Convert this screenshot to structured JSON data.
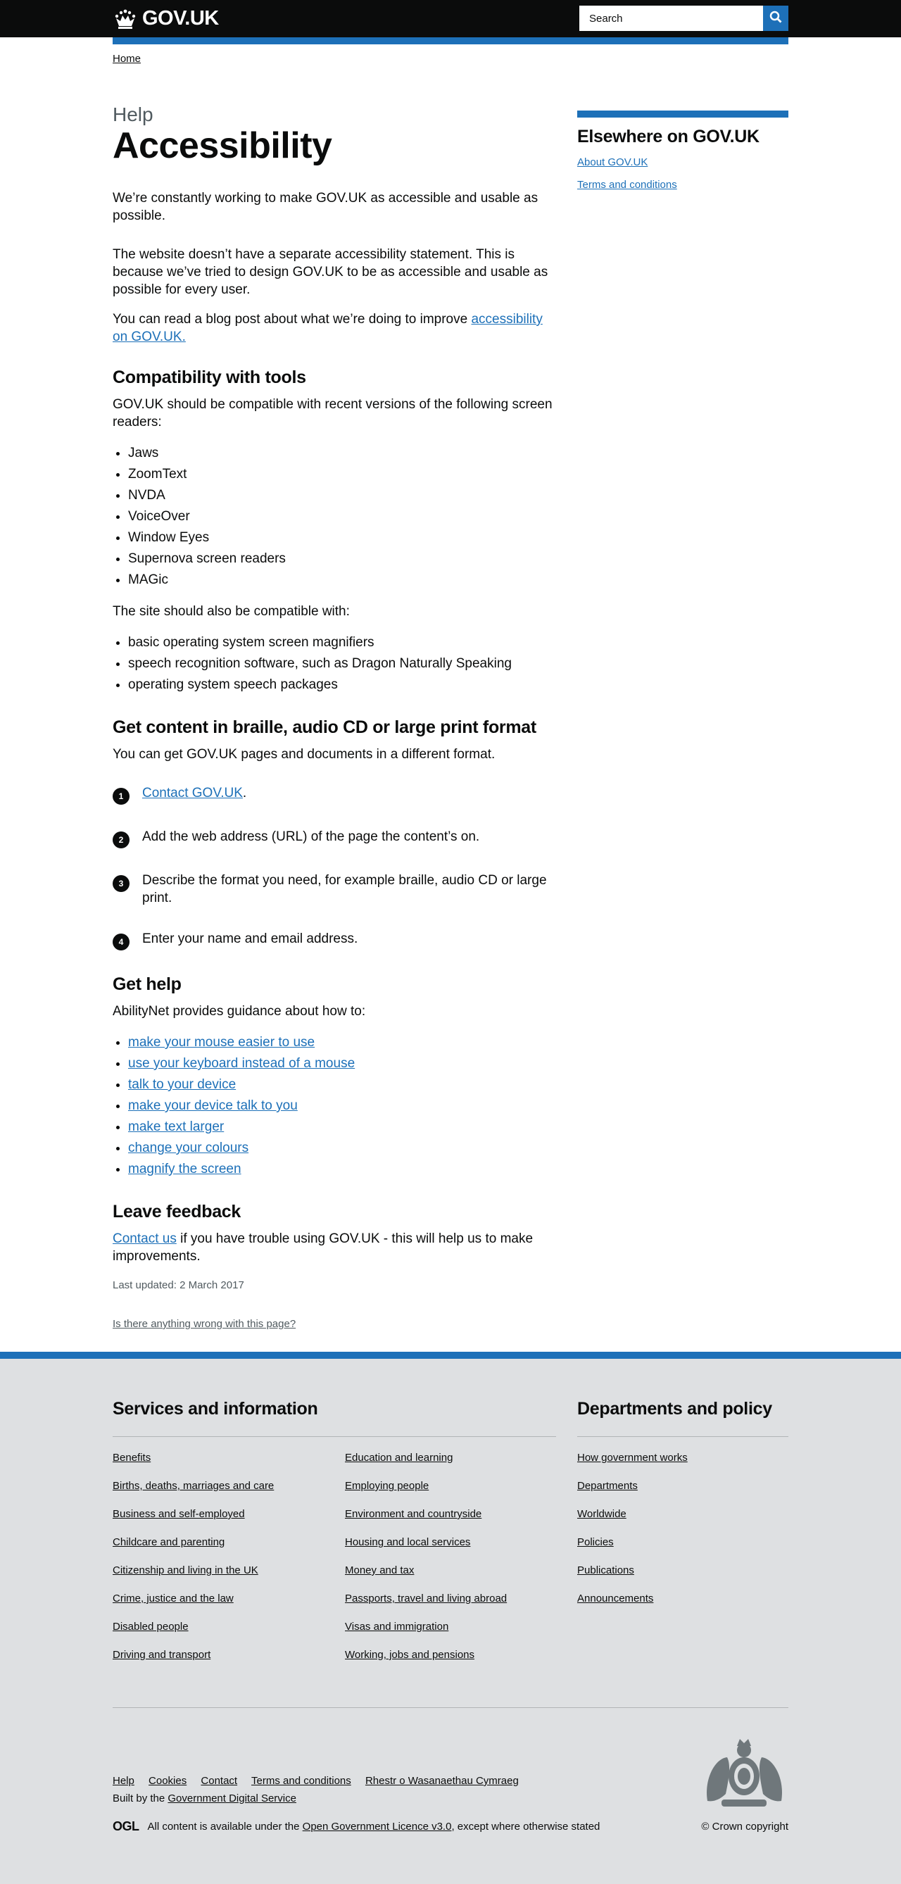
{
  "header": {
    "logo_text": "GOV.UK",
    "search_placeholder": "Search"
  },
  "breadcrumb": {
    "home": "Home"
  },
  "main": {
    "caption": "Help",
    "title": "Accessibility",
    "lead": "We’re constantly working to make GOV.UK as accessible and usable as possible.",
    "para1": "The website doesn’t have a separate accessibility statement. This is because we’ve tried to design GOV.UK to be as accessible and usable as possible for every user.",
    "para2_text": "You can read a blog post about what we’re doing to improve ",
    "para2_link": "accessibility on GOV.UK.",
    "compat": {
      "heading": "Compatibility with tools",
      "intro": "GOV.UK should be compatible with recent versions of the following screen readers:",
      "screen_readers": [
        "Jaws",
        "ZoomText",
        "NVDA",
        "VoiceOver",
        "Window Eyes",
        "Supernova screen readers",
        "MAGic"
      ],
      "also": "The site should also be compatible with:",
      "others": [
        "basic operating system screen magnifiers",
        "speech recognition software, such as Dragon Naturally Speaking",
        "operating system speech packages"
      ]
    },
    "formats": {
      "heading": "Get content in braille, audio CD or large print format",
      "intro": "You can get GOV.UK pages and documents in a different format.",
      "step1_link": "Contact GOV.UK",
      "step1_suffix": ".",
      "step2": "Add the web address (URL) of the page the content’s on.",
      "step3": "Describe the format you need, for example braille, audio CD or large print.",
      "step4": "Enter your name and email address.",
      "numbers": [
        "1",
        "2",
        "3",
        "4"
      ]
    },
    "help": {
      "heading": "Get help",
      "intro": "AbilityNet provides guidance about how to:",
      "links": [
        "make your mouse easier to use",
        "use your keyboard instead of a mouse",
        "talk to your device",
        "make your device talk to you",
        "make text larger",
        "change your colours",
        "magnify the screen"
      ]
    },
    "feedback": {
      "heading": "Leave feedback",
      "link": "Contact us",
      "text": " if you have trouble using GOV.UK - this will help us to make improvements."
    },
    "last_updated": "Last updated: 2 March 2017",
    "report_link": "Is there anything wrong with this page?"
  },
  "sidebar": {
    "title": "Elsewhere on GOV.UK",
    "links": [
      "About GOV.UK",
      "Terms and conditions"
    ]
  },
  "footer": {
    "services_heading": "Services and information",
    "services_col1": [
      "Benefits",
      "Births, deaths, marriages and care",
      "Business and self-employed",
      "Childcare and parenting",
      "Citizenship and living in the UK",
      "Crime, justice and the law",
      "Disabled people",
      "Driving and transport"
    ],
    "services_col2": [
      "Education and learning",
      "Employing people",
      "Environment and countryside",
      "Housing and local services",
      "Money and tax",
      "Passports, travel and living abroad",
      "Visas and immigration",
      "Working, jobs and pensions"
    ],
    "depts_heading": "Departments and policy",
    "depts": [
      "How government works",
      "Departments",
      "Worldwide",
      "Policies",
      "Publications",
      "Announcements"
    ],
    "meta_links": [
      "Help",
      "Cookies",
      "Contact",
      "Terms and conditions",
      "Rhestr o Wasanaethau Cymraeg"
    ],
    "built_by_text": "Built by the ",
    "built_by_link": "Government Digital Service",
    "ogl": "OGL",
    "licence_text": "All content is available under the ",
    "licence_link": "Open Government Licence v3.0",
    "licence_suffix": ", except where otherwise stated",
    "copyright": "© Crown copyright"
  },
  "colors": {
    "brand_blue": "#1d70b8",
    "black": "#0b0c0c",
    "footer_bg": "#dee0e2",
    "secondary_text": "#505a5f"
  }
}
